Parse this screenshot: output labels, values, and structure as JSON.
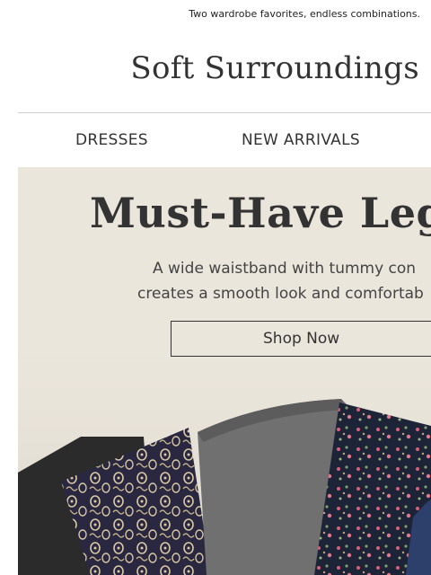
{
  "preheader": "Two wardrobe favorites, endless combinations.",
  "brand": {
    "name": "Soft Surroundings"
  },
  "nav": {
    "items": [
      "DRESSES",
      "NEW ARRIVALS"
    ]
  },
  "hero": {
    "title": "Must-Have Legg",
    "subtitle_line1": "A wide waistband with tummy con",
    "subtitle_line2": "creates a smooth look and comfortab",
    "cta": "Shop Now",
    "background": "#ebe6dc"
  },
  "icons": [
    "leggings-product-image"
  ]
}
